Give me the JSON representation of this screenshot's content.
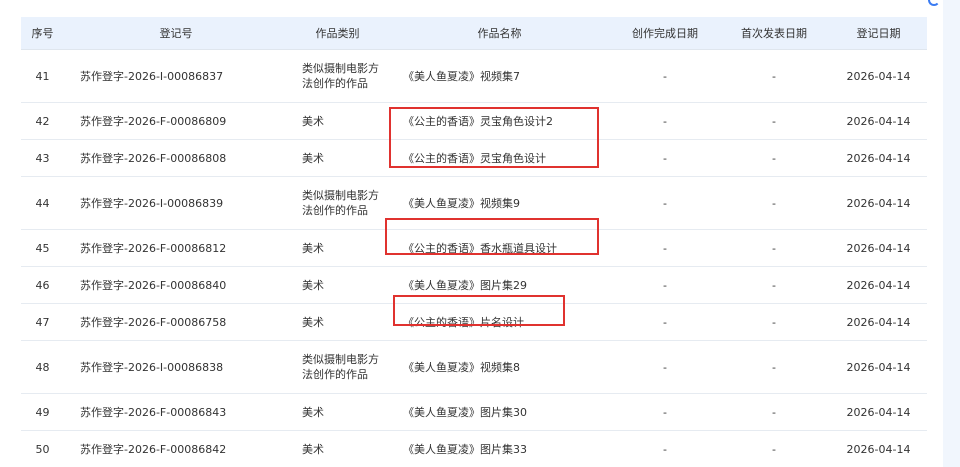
{
  "table": {
    "headers": {
      "index": "序号",
      "registration_no": "登记号",
      "category": "作品类别",
      "work_name": "作品名称",
      "completion_date": "创作完成日期",
      "first_publish_date": "首次发表日期",
      "registration_date": "登记日期"
    },
    "rows": [
      {
        "index": "41",
        "registration_no": "苏作登字-2026-I-00086837",
        "category": "类似摄制电影方法创作的作品",
        "work_name": "《美人鱼夏凌》视频集7",
        "completion_date": "-",
        "first_publish_date": "-",
        "registration_date": "2026-04-14"
      },
      {
        "index": "42",
        "registration_no": "苏作登字-2026-F-00086809",
        "category": "美术",
        "work_name": "《公主的香语》灵宝角色设计2",
        "completion_date": "-",
        "first_publish_date": "-",
        "registration_date": "2026-04-14"
      },
      {
        "index": "43",
        "registration_no": "苏作登字-2026-F-00086808",
        "category": "美术",
        "work_name": "《公主的香语》灵宝角色设计",
        "completion_date": "-",
        "first_publish_date": "-",
        "registration_date": "2026-04-14"
      },
      {
        "index": "44",
        "registration_no": "苏作登字-2026-I-00086839",
        "category": "类似摄制电影方法创作的作品",
        "work_name": "《美人鱼夏凌》视频集9",
        "completion_date": "-",
        "first_publish_date": "-",
        "registration_date": "2026-04-14"
      },
      {
        "index": "45",
        "registration_no": "苏作登字-2026-F-00086812",
        "category": "美术",
        "work_name": "《公主的香语》香水瓶道具设计",
        "completion_date": "-",
        "first_publish_date": "-",
        "registration_date": "2026-04-14"
      },
      {
        "index": "46",
        "registration_no": "苏作登字-2026-F-00086840",
        "category": "美术",
        "work_name": "《美人鱼夏凌》图片集29",
        "completion_date": "-",
        "first_publish_date": "-",
        "registration_date": "2026-04-14"
      },
      {
        "index": "47",
        "registration_no": "苏作登字-2026-F-00086758",
        "category": "美术",
        "work_name": "《公主的香语》片名设计",
        "completion_date": "-",
        "first_publish_date": "-",
        "registration_date": "2026-04-14"
      },
      {
        "index": "48",
        "registration_no": "苏作登字-2026-I-00086838",
        "category": "类似摄制电影方法创作的作品",
        "work_name": "《美人鱼夏凌》视频集8",
        "completion_date": "-",
        "first_publish_date": "-",
        "registration_date": "2026-04-14"
      },
      {
        "index": "49",
        "registration_no": "苏作登字-2026-F-00086843",
        "category": "美术",
        "work_name": "《美人鱼夏凌》图片集30",
        "completion_date": "-",
        "first_publish_date": "-",
        "registration_date": "2026-04-14"
      },
      {
        "index": "50",
        "registration_no": "苏作登字-2026-F-00086842",
        "category": "美术",
        "work_name": "《美人鱼夏凌》图片集33",
        "completion_date": "-",
        "first_publish_date": "-",
        "registration_date": "2026-04-14"
      }
    ]
  },
  "colors": {
    "header_bg": "#eaf2fd",
    "highlight_box": "#e0322f",
    "accent": "#3a7bf2",
    "side_panel_bg": "#f1f6fd"
  }
}
